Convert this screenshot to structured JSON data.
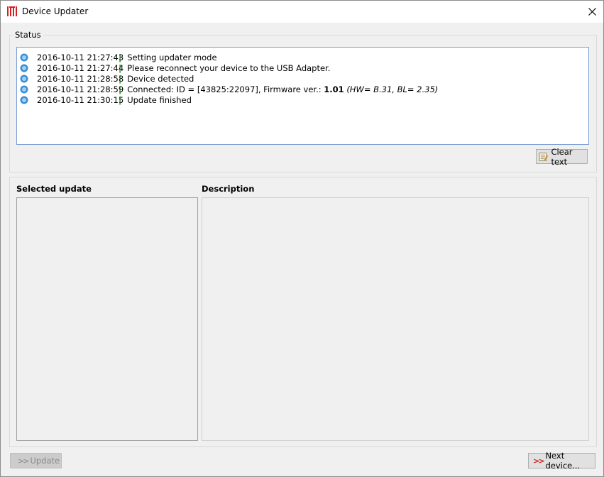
{
  "window": {
    "title": "Device Updater"
  },
  "status": {
    "label": "Status",
    "log": [
      {
        "time": "2016-10-11 21:27:43",
        "message": "Setting updater mode"
      },
      {
        "time": "2016-10-11 21:27:44",
        "message": "Please reconnect your device to the USB Adapter."
      },
      {
        "time": "2016-10-11 21:28:58",
        "message": "Device detected"
      },
      {
        "time": "2016-10-11 21:28:59",
        "message_prefix": "Connected: ID = [43825:22097], Firmware ver.: ",
        "firmware": "1.01",
        "hw_info": "(HW= B.31, BL= 2.35)"
      },
      {
        "time": "2016-10-11 21:30:15",
        "message": "Update finished"
      }
    ],
    "separator": "|",
    "clear_button": "Clear text"
  },
  "panels": {
    "selected_update_label": "Selected update",
    "description_label": "Description"
  },
  "footer": {
    "update_button": "Update",
    "next_device_button": "Next device..."
  },
  "colors": {
    "log_border": "#7a9cd3",
    "separator": "#1e6b1e",
    "chevron_red": "#cc2222"
  },
  "icons": {
    "app": "jeti-logo-icon",
    "log": "info-icon",
    "clear": "notepad-icon"
  }
}
